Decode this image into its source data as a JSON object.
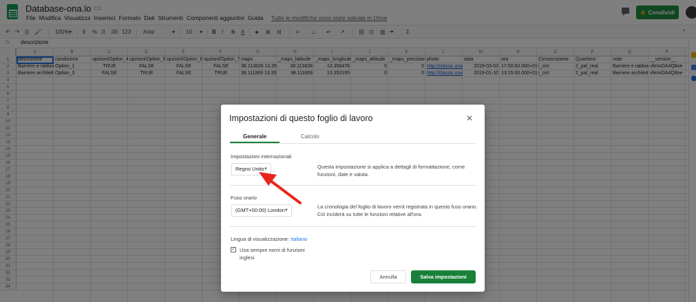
{
  "header": {
    "title": "Database-ona.io",
    "menu": [
      "File",
      "Modifica",
      "Visualizza",
      "Inserisci",
      "Formato",
      "Dati",
      "Strumenti",
      "Componenti aggiuntivi",
      "Guida"
    ],
    "saved_message": "Tutte le modifiche sono state salvate in Drive",
    "share_label": "Condividi"
  },
  "toolbar": {
    "zoom": "100%",
    "currency": "€",
    "percent": "%",
    "decimals_less": ".0",
    "decimals_more": ".00",
    "number_format": "123",
    "font": "Arial",
    "font_size": "10",
    "bold": "B",
    "italic": "I",
    "strike": "S",
    "text_color": "A",
    "sigma": "Σ"
  },
  "formula_bar": {
    "fx": "fx",
    "value": "descrizione"
  },
  "grid": {
    "columns": [
      "A",
      "B",
      "C",
      "D",
      "E",
      "F",
      "G",
      "H",
      "I",
      "J",
      "K",
      "L",
      "M",
      "N",
      "O",
      "P",
      "Q",
      "R"
    ],
    "rows": [
      "1",
      "2",
      "3",
      "4",
      "5",
      "6",
      "7",
      "8",
      "9",
      "10",
      "11",
      "12",
      "13",
      "14",
      "15",
      "16",
      "17",
      "18",
      "19",
      "20",
      "21",
      "22",
      "23",
      "24",
      "25",
      "26",
      "27",
      "28",
      "29",
      "30",
      "31",
      "32",
      "33",
      "34"
    ],
    "data": [
      [
        "descrizione",
        "condizione",
        "opzioni/Option_4",
        "opzioni/Option_5",
        "opzioni/Option_6",
        "opzioni/Option_7",
        "maps",
        "_maps_latitude",
        "_maps_longitude",
        "_maps_altitude",
        "_maps_precision",
        "photo",
        "data",
        "ora",
        "Circoscrizione",
        "Quartiere",
        "note",
        "__version__"
      ],
      [
        "Barriere e rabbia",
        "Option_1",
        "TRUE",
        "FALSE",
        "FALSE",
        "FALSE",
        "38.113828 13.356",
        "38.113828",
        "13.356476",
        "0",
        "0",
        "http://classic.ona",
        "2019-03-03",
        "17:00:00.000+01",
        "i_circ",
        "2_pal_real",
        "Barriere e rabbia",
        "vfenxDA4Q8oe"
      ],
      [
        "Barriere architett",
        "Option_3",
        "FALSE",
        "TRUE",
        "FALSE",
        "TRUE",
        "38.111869 13.353",
        "38.111869",
        "13.353195",
        "0",
        "0",
        "http://classic.ona",
        "2019-01-10",
        "13:15:00.000+01",
        "i_circ",
        "2_pal_real",
        "Barriere architett",
        "vfenxDA4Q8oe"
      ]
    ]
  },
  "dialog": {
    "title": "Impostazioni di questo foglio di lavoro",
    "tabs": [
      "Generale",
      "Calcolo"
    ],
    "locale_label": "Impostazioni internazionali",
    "locale_value": "Regno Unito",
    "locale_desc": "Questa impostazione si applica a dettagli di formattazione, come funzioni, date e valuta.",
    "timezone_label": "Fuso orario",
    "timezone_value": "(GMT+00:00) London",
    "timezone_desc": "La cronologia del foglio di lavoro verrà registrata in questo fuso orario. Ciò inciderà su tutte le funzioni relative all'ora.",
    "display_lang_label": "Lingua di visualizzazione:",
    "display_lang_value": "Italiano",
    "checkbox_label": "Usa sempre nomi di funzioni inglesi",
    "checkbox_checked": true,
    "cancel_label": "Annulla",
    "save_label": "Salva impostazioni"
  },
  "colors": {
    "accent_green": "#188038",
    "share_green": "#1e8e3e",
    "arrow_red": "#e8261c",
    "link_blue": "#1155cc"
  }
}
